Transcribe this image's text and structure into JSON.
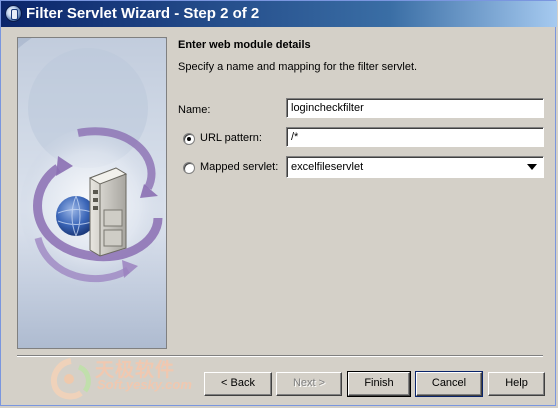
{
  "window": {
    "title": "Filter Servlet Wizard - Step 2 of 2"
  },
  "main": {
    "heading": "Enter web module details",
    "description": "Specify a name and mapping for the filter servlet.",
    "name_label": "Name:",
    "name_value": "logincheckfilter",
    "url_pattern_label": "URL pattern:",
    "url_pattern_value": "/*",
    "url_pattern_selected": true,
    "mapped_servlet_label": "Mapped servlet:",
    "mapped_servlet_value": "excelfileservlet",
    "mapped_servlet_selected": false
  },
  "buttons": {
    "back": "< Back",
    "next": "Next >",
    "finish": "Finish",
    "cancel": "Cancel",
    "help": "Help"
  },
  "watermark": {
    "text_cn": "天极软件",
    "url": "Soft.yesky.com"
  },
  "colors": {
    "titlebar_start": "#0a246a",
    "titlebar_end": "#a6caf0",
    "dialog_bg": "#d4d0c8",
    "illustration_arrow": "#8b6fb3"
  },
  "icons": {
    "window_icon": "app-icon",
    "close": "close-icon",
    "illustration": "server-globe-illustration",
    "dropdown": "chevron-down-icon"
  }
}
